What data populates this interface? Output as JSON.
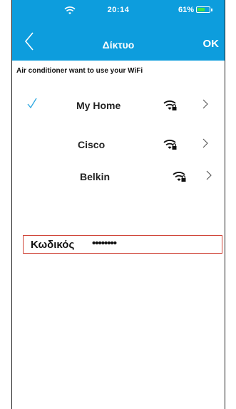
{
  "status_bar": {
    "time": "20:14",
    "battery_text": "61%",
    "battery_level": 0.61,
    "wifi_icon": "wifi-icon",
    "battery_color": "#44e244"
  },
  "header": {
    "title": "Δίκτυο",
    "ok_label": "OK",
    "back_icon": "chevron-left-icon",
    "background": "#0d9ddd"
  },
  "subtitle": "Air conditioner want to use your WiFi",
  "networks": [
    {
      "name": "My Home",
      "selected": true,
      "icon": "wifi-lock-icon"
    },
    {
      "name": "Cisco",
      "selected": false,
      "icon": "wifi-lock-icon"
    },
    {
      "name": "Belkin",
      "selected": false,
      "icon": "wifi-lock-icon"
    }
  ],
  "password": {
    "label": "Κωδικός",
    "value": "••••••••"
  },
  "colors": {
    "accent": "#0d9ddd",
    "password_border": "#d0463a"
  }
}
